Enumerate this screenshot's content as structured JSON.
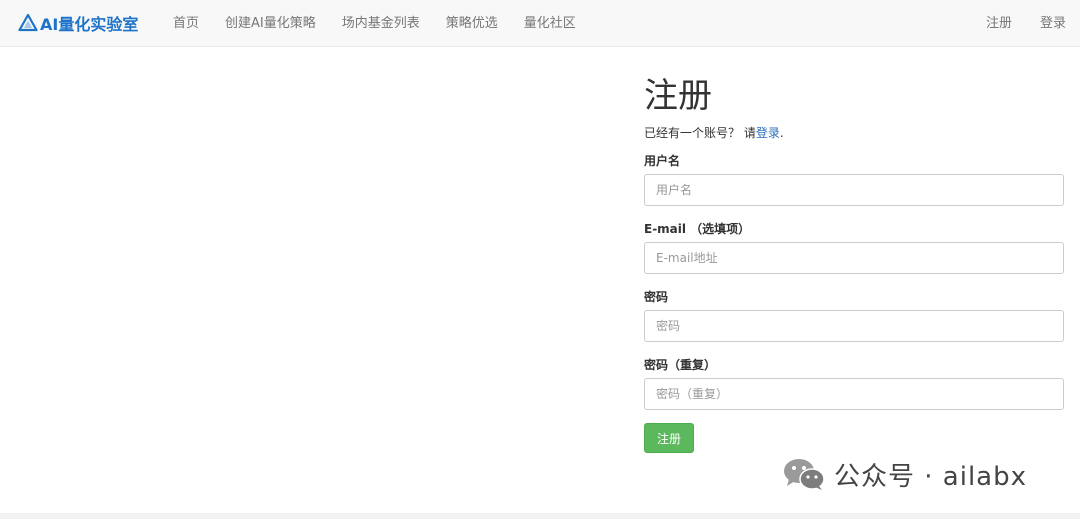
{
  "brand": {
    "name": "AI量化实验室",
    "color": "#1e73c9"
  },
  "nav": {
    "left": [
      {
        "label": "首页"
      },
      {
        "label": "创建AI量化策略"
      },
      {
        "label": "场内基金列表"
      },
      {
        "label": "策略优选"
      },
      {
        "label": "量化社区"
      }
    ],
    "right": [
      {
        "label": "注册"
      },
      {
        "label": "登录"
      }
    ]
  },
  "form": {
    "title": "注册",
    "hint_prefix": "已经有一个账号？ 请",
    "hint_link": "登录",
    "hint_suffix": ".",
    "fields": [
      {
        "label": "用户名",
        "placeholder": "用户名"
      },
      {
        "label": "E-mail （选填项）",
        "placeholder": "E-mail地址"
      },
      {
        "label": "密码",
        "placeholder": "密码"
      },
      {
        "label": "密码（重复）",
        "placeholder": "密码（重复）"
      }
    ],
    "submit_label": "注册",
    "submit_color": "#5cb85c"
  },
  "watermark": {
    "text": "公众号 · ailabx",
    "icon": "wechat-icon"
  }
}
